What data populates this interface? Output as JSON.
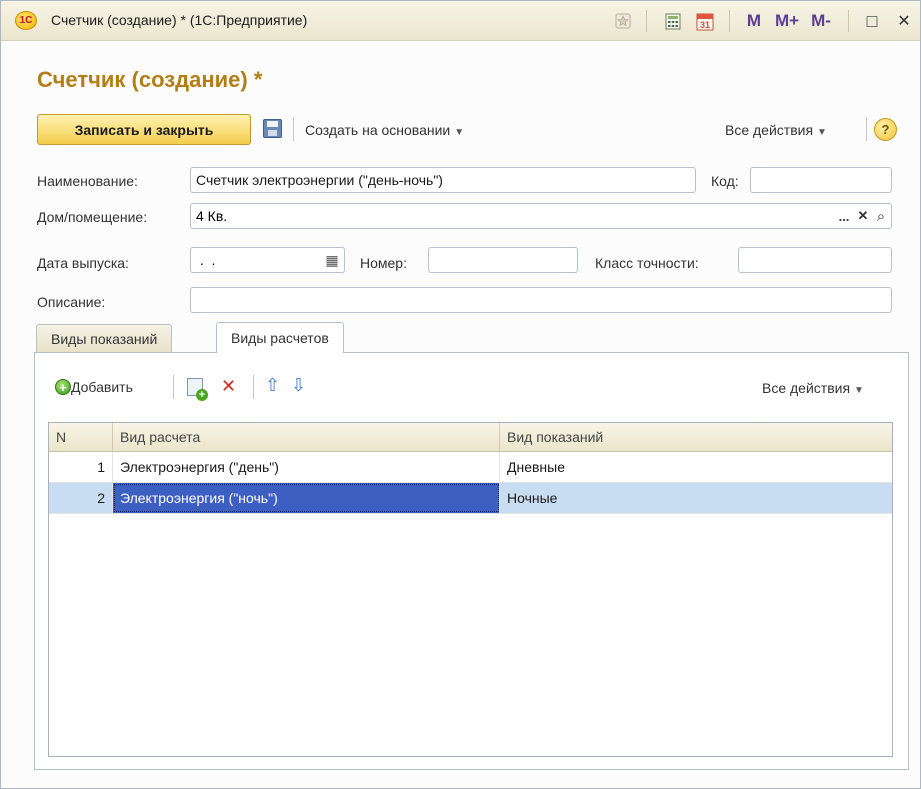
{
  "window": {
    "title": "Счетчик (создание) * (1С:Предприятие)",
    "logo_text": "1С",
    "toolbar_icons": [
      "favorite-star-icon",
      "calculator-icon",
      "calendar-icon"
    ],
    "calendar_day": "31",
    "memory_buttons": [
      "M",
      "M+",
      "M-"
    ],
    "restore_glyph": "□",
    "close_glyph": "✕"
  },
  "form": {
    "title": "Счетчик (создание) *",
    "toolbar": {
      "save_close": "Записать и закрыть",
      "create_based_on": "Создать на основании",
      "all_actions": "Все действия",
      "help_glyph": "?"
    },
    "fields": {
      "name_label": "Наименование:",
      "name_value": "Счетчик электроэнергии (\"день-ночь\")",
      "code_label": "Код:",
      "code_value": "",
      "house_label": "Дом/помещение:",
      "house_value": "4 Кв.",
      "select_glyph": "...",
      "clear_glyph": "✕",
      "open_glyph": "⌕",
      "release_date_label": "Дата выпуска:",
      "release_date_value": " .  .",
      "calendar_glyph": "▦",
      "number_label": "Номер:",
      "number_value": "",
      "accuracy_label": "Класс точности:",
      "accuracy_value": "",
      "description_label": "Описание:",
      "description_value": ""
    }
  },
  "tabs": [
    {
      "label": "Виды показаний",
      "active": false
    },
    {
      "label": "Виды расчетов",
      "active": true
    }
  ],
  "table": {
    "toolbar": {
      "add": "Добавить",
      "all_actions": "Все действия",
      "add_glyph": "+",
      "delete_glyph": "✕",
      "up_glyph": "⇧",
      "down_glyph": "⇩"
    },
    "columns": [
      "N",
      "Вид расчета",
      "Вид показаний"
    ],
    "rows": [
      {
        "n": "1",
        "calc_type": "Электроэнергия (\"день\")",
        "reading_type": "Дневные",
        "selected": false
      },
      {
        "n": "2",
        "calc_type": "Электроэнергия (\"ночь\")",
        "reading_type": "Ночные",
        "selected": true
      }
    ]
  },
  "colors": {
    "title_accent": "#b37e15",
    "primary_button": "#f3cd4c",
    "selection_cell": "#3d5fc1",
    "selection_row": "#c8dcf2"
  }
}
